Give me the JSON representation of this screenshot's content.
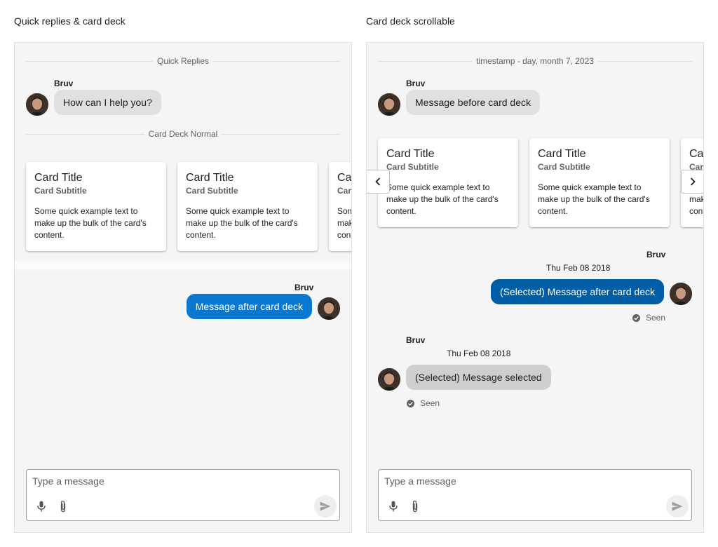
{
  "left_panel": {
    "title": "Quick replies & card deck",
    "divider_quick": "Quick Replies",
    "msg1": {
      "sender": "Bruv",
      "text": "How can I help you?"
    },
    "divider_cards": "Card Deck Normal",
    "cards": [
      {
        "title": "Card Title",
        "subtitle": "Card Subtitle",
        "text": "Some quick example text to make up the bulk of the card's content."
      },
      {
        "title": "Card Title",
        "subtitle": "Card Subtitle",
        "text": "Some quick example text to make up the bulk of the card's content."
      },
      {
        "title": "Card Title",
        "subtitle": "Card Subtitle",
        "text": "Some quick example text to make up the bulk of the card's content."
      }
    ],
    "msg2": {
      "sender": "Bruv",
      "text": "Message after card deck"
    },
    "composer": {
      "placeholder": "Type a message"
    }
  },
  "right_panel": {
    "title": "Card deck scrollable",
    "divider_timestamp": "timestamp - day, month 7, 2023",
    "msg1": {
      "sender": "Bruv",
      "text": "Message before card deck"
    },
    "cards": [
      {
        "title": "Card Title",
        "subtitle": "Card Subtitle",
        "text": "Some quick example text to make up the bulk of the card's content."
      },
      {
        "title": "Card Title",
        "subtitle": "Card Subtitle",
        "text": "Some quick example text to make up the bulk of the card's content."
      },
      {
        "title": "Card Title",
        "subtitle": "Card Subtitle",
        "text": "Some quick example text to make up the bulk of the card's content."
      }
    ],
    "msg2": {
      "sender": "Bruv",
      "timestamp": "Thu Feb 08 2018",
      "text": "(Selected) Message after card deck",
      "status": "Seen"
    },
    "msg3": {
      "sender": "Bruv",
      "timestamp": "Thu Feb 08 2018",
      "text": "(Selected) Message selected",
      "status": "Seen"
    },
    "composer": {
      "placeholder": "Type a message"
    }
  },
  "icons": {
    "mic": "mic-icon",
    "attach": "paperclip-icon",
    "send": "send-icon",
    "seen": "check-circle-icon",
    "prev": "chevron-left-icon",
    "next": "chevron-right-icon"
  },
  "colors": {
    "outgoing_bubble": "#0a78d1",
    "outgoing_selected_bubble": "#005ea6",
    "incoming_bubble": "#e0e0e0",
    "panel_background": "#f5f5f5"
  }
}
